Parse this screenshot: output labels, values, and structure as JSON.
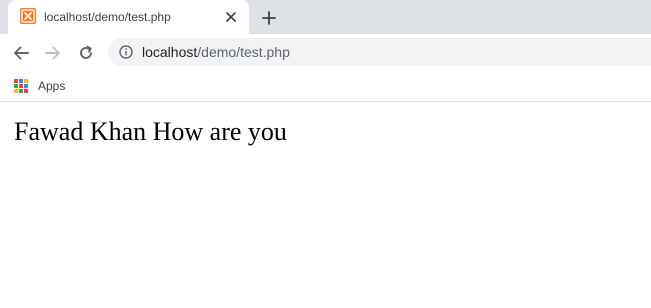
{
  "tab": {
    "title": "localhost/demo/test.php",
    "favicon": "xampp-icon",
    "close": "close-icon"
  },
  "toolbar": {
    "back": "back-arrow-icon",
    "forward": "forward-arrow-icon",
    "reload": "reload-icon",
    "new_tab": "plus-icon"
  },
  "omnibox": {
    "info": "info-icon",
    "url_host": "localhost",
    "url_path": "/demo/test.php"
  },
  "bookmarks": {
    "apps_label": "Apps",
    "apps_icon": "apps-grid-icon"
  },
  "page": {
    "text": "Fawad Khan How are you"
  },
  "colors": {
    "tabstrip": "#dee1e6",
    "omnibox": "#f1f3f4",
    "xampp_orange": "#fb7a24"
  }
}
